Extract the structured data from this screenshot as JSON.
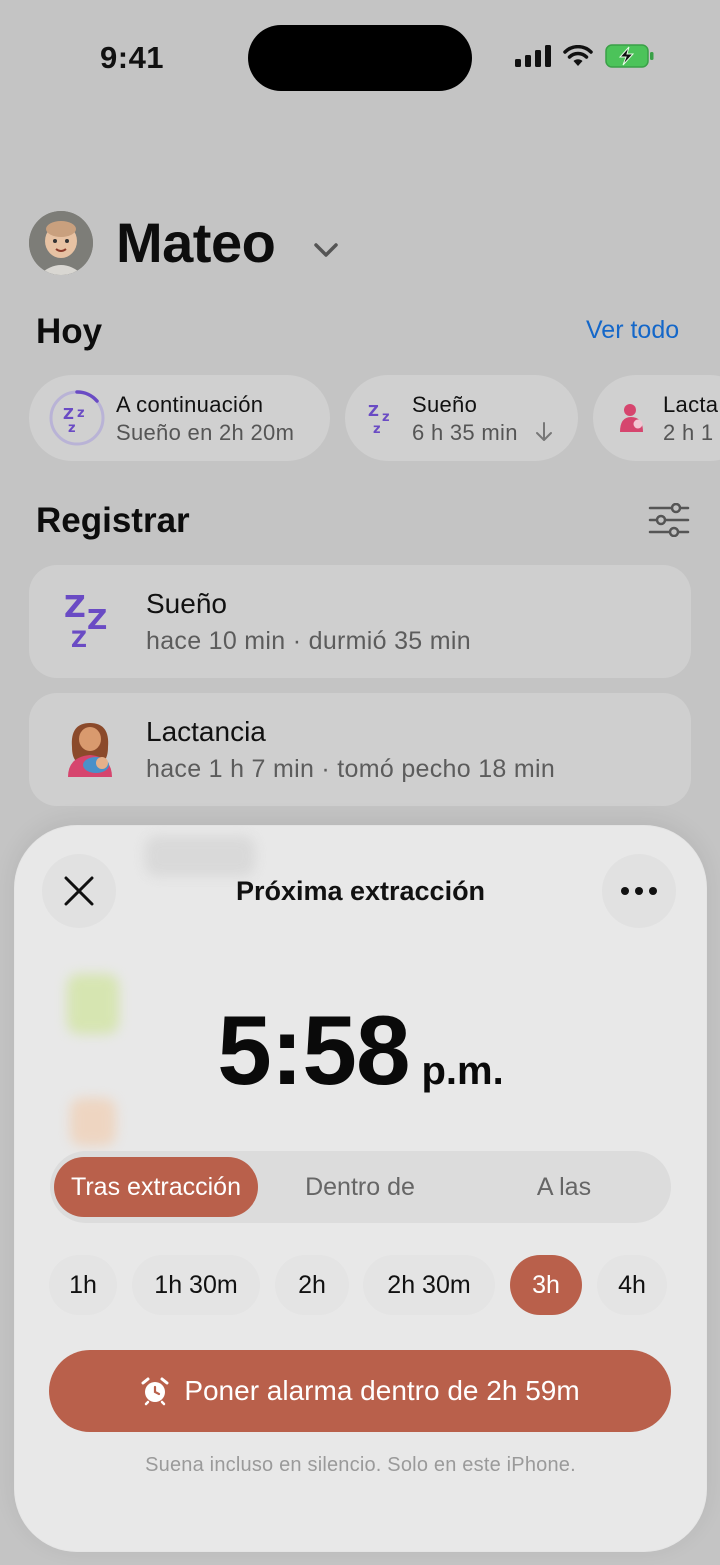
{
  "status_bar": {
    "time": "9:41"
  },
  "header": {
    "child_name": "Mateo"
  },
  "today": {
    "title": "Hoy",
    "see_all": "Ver todo",
    "chips": [
      {
        "title": "A continuación",
        "subtitle": "Sueño en 2h 20m",
        "icon": "sleep-zz-icon"
      },
      {
        "title": "Sueño",
        "subtitle": "6 h 35 min",
        "trend_icon": "arrow-down-icon",
        "icon": "sleep-zz-icon"
      },
      {
        "title": "Lacta",
        "subtitle": "2 h 1",
        "icon": "breastfeeding-icon"
      }
    ]
  },
  "log": {
    "title": "Registrar",
    "items": [
      {
        "title": "Sueño",
        "subtitle": "hace 10 min · durmió 35 min",
        "icon": "sleep-zz-icon"
      },
      {
        "title": "Lactancia",
        "subtitle": "hace 1 h 7 min · tomó pecho 18 min",
        "icon": "breastfeeding-icon"
      }
    ]
  },
  "sheet": {
    "title": "Próxima extracción",
    "time": "5:58",
    "ampm": "p.m.",
    "modes": [
      "Tras extracción",
      "Dentro de",
      "A las"
    ],
    "selected_mode": "Tras extracción",
    "durations": [
      "1h",
      "1h 30m",
      "2h",
      "2h 30m",
      "3h",
      "4h"
    ],
    "selected_duration": "3h",
    "alarm_button": "Poner alarma dentro de 2h 59m",
    "footnote": "Suena incluso en silencio. Solo en este iPhone."
  },
  "colors": {
    "accent": "#b9604b",
    "link": "#1467c9",
    "sleep": "#6a4bc4",
    "feeding": "#d6456e"
  }
}
